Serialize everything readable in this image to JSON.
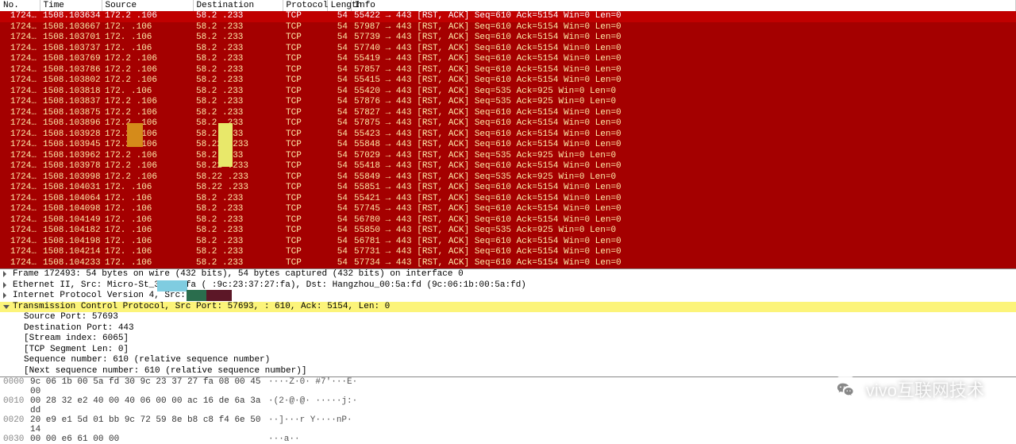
{
  "columns": {
    "no": "No.",
    "time": "Time",
    "source": "Source",
    "destination": "Destination",
    "protocol": "Protocol",
    "length": "Length",
    "info": "Info"
  },
  "packets": [
    {
      "no": "1724…",
      "time": "1508.103634",
      "src": "172.2   .106",
      "dst": "58.2   .233",
      "proto": "TCP",
      "len": "54",
      "info": "55422 → 443 [RST, ACK] Seq=610 Ack=5154 Win=0 Len=0",
      "sel": true
    },
    {
      "no": "1724…",
      "time": "1508.103667",
      "src": "172.    .106",
      "dst": "58.2   .233",
      "proto": "TCP",
      "len": "54",
      "info": "57987 → 443 [RST, ACK] Seq=610 Ack=5154 Win=0 Len=0"
    },
    {
      "no": "1724…",
      "time": "1508.103701",
      "src": "172.    .106",
      "dst": "58.2   .233",
      "proto": "TCP",
      "len": "54",
      "info": "57739 → 443 [RST, ACK] Seq=610 Ack=5154 Win=0 Len=0"
    },
    {
      "no": "1724…",
      "time": "1508.103737",
      "src": "172.    .106",
      "dst": "58.2   .233",
      "proto": "TCP",
      "len": "54",
      "info": "57740 → 443 [RST, ACK] Seq=610 Ack=5154 Win=0 Len=0"
    },
    {
      "no": "1724…",
      "time": "1508.103769",
      "src": "172.2   .106",
      "dst": "58.2   .233",
      "proto": "TCP",
      "len": "54",
      "info": "55419 → 443 [RST, ACK] Seq=610 Ack=5154 Win=0 Len=0"
    },
    {
      "no": "1724…",
      "time": "1508.103786",
      "src": "172.2   .106",
      "dst": "58.2   .233",
      "proto": "TCP",
      "len": "54",
      "info": "57857 → 443 [RST, ACK] Seq=610 Ack=5154 Win=0 Len=0"
    },
    {
      "no": "1724…",
      "time": "1508.103802",
      "src": "172.2   .106",
      "dst": "58.2   .233",
      "proto": "TCP",
      "len": "54",
      "info": "55415 → 443 [RST, ACK] Seq=610 Ack=5154 Win=0 Len=0"
    },
    {
      "no": "1724…",
      "time": "1508.103818",
      "src": "172.    .106",
      "dst": "58.2   .233",
      "proto": "TCP",
      "len": "54",
      "info": "55420 → 443 [RST, ACK] Seq=535 Ack=925 Win=0 Len=0"
    },
    {
      "no": "1724…",
      "time": "1508.103837",
      "src": "172.2   .106",
      "dst": "58.2   .233",
      "proto": "TCP",
      "len": "54",
      "info": "57876 → 443 [RST, ACK] Seq=535 Ack=925 Win=0 Len=0"
    },
    {
      "no": "1724…",
      "time": "1508.103875",
      "src": "172.2   .106",
      "dst": "58.2   .233",
      "proto": "TCP",
      "len": "54",
      "info": "57827 → 443 [RST, ACK] Seq=610 Ack=5154 Win=0 Len=0"
    },
    {
      "no": "1724…",
      "time": "1508.103896",
      "src": "172.2   .106",
      "dst": "58.2   .233",
      "proto": "TCP",
      "len": "54",
      "info": "57875 → 443 [RST, ACK] Seq=610 Ack=5154 Win=0 Len=0"
    },
    {
      "no": "1724…",
      "time": "1508.103928",
      "src": "172.2   .106",
      "dst": "58.2   .233",
      "proto": "TCP",
      "len": "54",
      "info": "55423 → 443 [RST, ACK] Seq=610 Ack=5154 Win=0 Len=0"
    },
    {
      "no": "1724…",
      "time": "1508.103945",
      "src": "172.2   .106",
      "dst": "58.22  .233",
      "proto": "TCP",
      "len": "54",
      "info": "55848 → 443 [RST, ACK] Seq=610 Ack=5154 Win=0 Len=0"
    },
    {
      "no": "1724…",
      "time": "1508.103962",
      "src": "172.2   .106",
      "dst": "58.2   .233",
      "proto": "TCP",
      "len": "54",
      "info": "57029 → 443 [RST, ACK] Seq=535 Ack=925 Win=0 Len=0"
    },
    {
      "no": "1724…",
      "time": "1508.103978",
      "src": "172.2   .106",
      "dst": "58.22  .233",
      "proto": "TCP",
      "len": "54",
      "info": "55418 → 443 [RST, ACK] Seq=610 Ack=5154 Win=0 Len=0"
    },
    {
      "no": "1724…",
      "time": "1508.103998",
      "src": "172.2   .106",
      "dst": "58.22  .233",
      "proto": "TCP",
      "len": "54",
      "info": "55849 → 443 [RST, ACK] Seq=535 Ack=925 Win=0 Len=0"
    },
    {
      "no": "1724…",
      "time": "1508.104031",
      "src": "172.    .106",
      "dst": "58.22  .233",
      "proto": "TCP",
      "len": "54",
      "info": "55851 → 443 [RST, ACK] Seq=610 Ack=5154 Win=0 Len=0"
    },
    {
      "no": "1724…",
      "time": "1508.104064",
      "src": "172.    .106",
      "dst": "58.2   .233",
      "proto": "TCP",
      "len": "54",
      "info": "55421 → 443 [RST, ACK] Seq=610 Ack=5154 Win=0 Len=0"
    },
    {
      "no": "1724…",
      "time": "1508.104098",
      "src": "172.    .106",
      "dst": "58.2   .233",
      "proto": "TCP",
      "len": "54",
      "info": "57745 → 443 [RST, ACK] Seq=610 Ack=5154 Win=0 Len=0"
    },
    {
      "no": "1724…",
      "time": "1508.104149",
      "src": "172.    .106",
      "dst": "58.2   .233",
      "proto": "TCP",
      "len": "54",
      "info": "56780 → 443 [RST, ACK] Seq=610 Ack=5154 Win=0 Len=0"
    },
    {
      "no": "1724…",
      "time": "1508.104182",
      "src": "172.    .106",
      "dst": "58.2   .233",
      "proto": "TCP",
      "len": "54",
      "info": "55850 → 443 [RST, ACK] Seq=535 Ack=925 Win=0 Len=0"
    },
    {
      "no": "1724…",
      "time": "1508.104198",
      "src": "172.    .106",
      "dst": "58.2   .233",
      "proto": "TCP",
      "len": "54",
      "info": "56781 → 443 [RST, ACK] Seq=610 Ack=5154 Win=0 Len=0"
    },
    {
      "no": "1724…",
      "time": "1508.104214",
      "src": "172.    .106",
      "dst": "58.2   .233",
      "proto": "TCP",
      "len": "54",
      "info": "57731 → 443 [RST, ACK] Seq=610 Ack=5154 Win=0 Len=0"
    },
    {
      "no": "1724…",
      "time": "1508.104233",
      "src": "172.    .106",
      "dst": "58.2   .233",
      "proto": "TCP",
      "len": "54",
      "info": "57734 → 443 [RST, ACK] Seq=610 Ack=5154 Win=0 Len=0"
    }
  ],
  "details": {
    "frame": "Frame 172493: 54 bytes on wire (432 bits), 54 bytes captured (432 bits) on interface 0",
    "eth": "Ethernet II, Src: Micro-St_37:27:fa (  :9c:23:37:27:fa), Dst: Hangzhou_00:5a:fd (9c:06:1b:00:5a:fd)",
    "ip": "Internet Protocol Version 4, Src:                                           3",
    "tcp": "Transmission Control Protocol, Src Port: 57693,                     : 610, Ack: 5154, Len: 0",
    "sub": [
      "Source Port: 57693",
      "Destination Port: 443",
      "[Stream index: 6065]",
      "[TCP Segment Len: 0]",
      "Sequence number: 610    (relative sequence number)",
      "[Next sequence number: 610    (relative sequence number)]"
    ]
  },
  "bytes": [
    {
      "off": "0000",
      "hex": "9c 06 1b 00 5a fd 30 9c  23 37 27 fa 08 00 45 00",
      "asc": "····Z·0· #7'···E·"
    },
    {
      "off": "0010",
      "hex": "00 28 32 e2 40 00 40 06  00 00 ac 16 de 6a 3a dd",
      "asc": "·(2·@·@· ·····j:·"
    },
    {
      "off": "0020",
      "hex": "20 e9 e1 5d 01 bb 9c 72  59 8e b8 c8 f4 6e 50 14",
      "asc": " ··]···r Y····nP·"
    },
    {
      "off": "0030",
      "hex": "00 00 e6 61 00 00",
      "asc": "···a··"
    }
  ],
  "watermark": "vivo互联网技术"
}
